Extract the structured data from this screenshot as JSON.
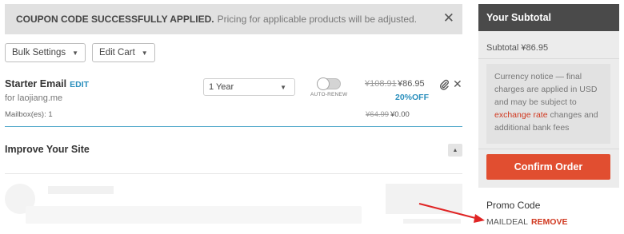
{
  "notice": {
    "strong": "COUPON CODE SUCCESSFULLY APPLIED.",
    "text": "Pricing for applicable products will be adjusted.",
    "close_glyph": "✕"
  },
  "toolbar": {
    "bulk_settings": "Bulk Settings",
    "edit_cart": "Edit Cart",
    "caret": "▼"
  },
  "cart_item": {
    "name": "Starter Email",
    "edit": "EDIT",
    "domain": "for laojiang.me",
    "mailboxes": "Mailbox(es): 1",
    "period": "1 Year",
    "auto_renew_label": "AUTO-RENEW",
    "auto_renew_on": false,
    "price_original": "¥108.91",
    "price_current": "¥86.95",
    "discount": "20%OFF",
    "mailbox_price_original": "¥64.99",
    "mailbox_price_current": "¥0.00",
    "attach_glyph": "🔗",
    "remove_glyph": "✕"
  },
  "improve": {
    "title": "Improve Your Site",
    "toggle_glyph": "▲"
  },
  "sidebar": {
    "title": "Your Subtotal",
    "subtotal": "Subtotal ¥86.95",
    "currency_notice_before": "Currency notice — final charges are applied in USD and may be subject to ",
    "currency_notice_link": "exchange rate",
    "currency_notice_after": " changes and additional bank fees",
    "confirm_button": "Confirm Order"
  },
  "promo": {
    "title": "Promo Code",
    "code": "MAILDEAL",
    "remove": "REMOVE"
  },
  "colors": {
    "accent_blue": "#2a8fbd",
    "confirm_red": "#e14e30",
    "link_red": "#d0381f",
    "header_dark": "#4a4a4a"
  }
}
